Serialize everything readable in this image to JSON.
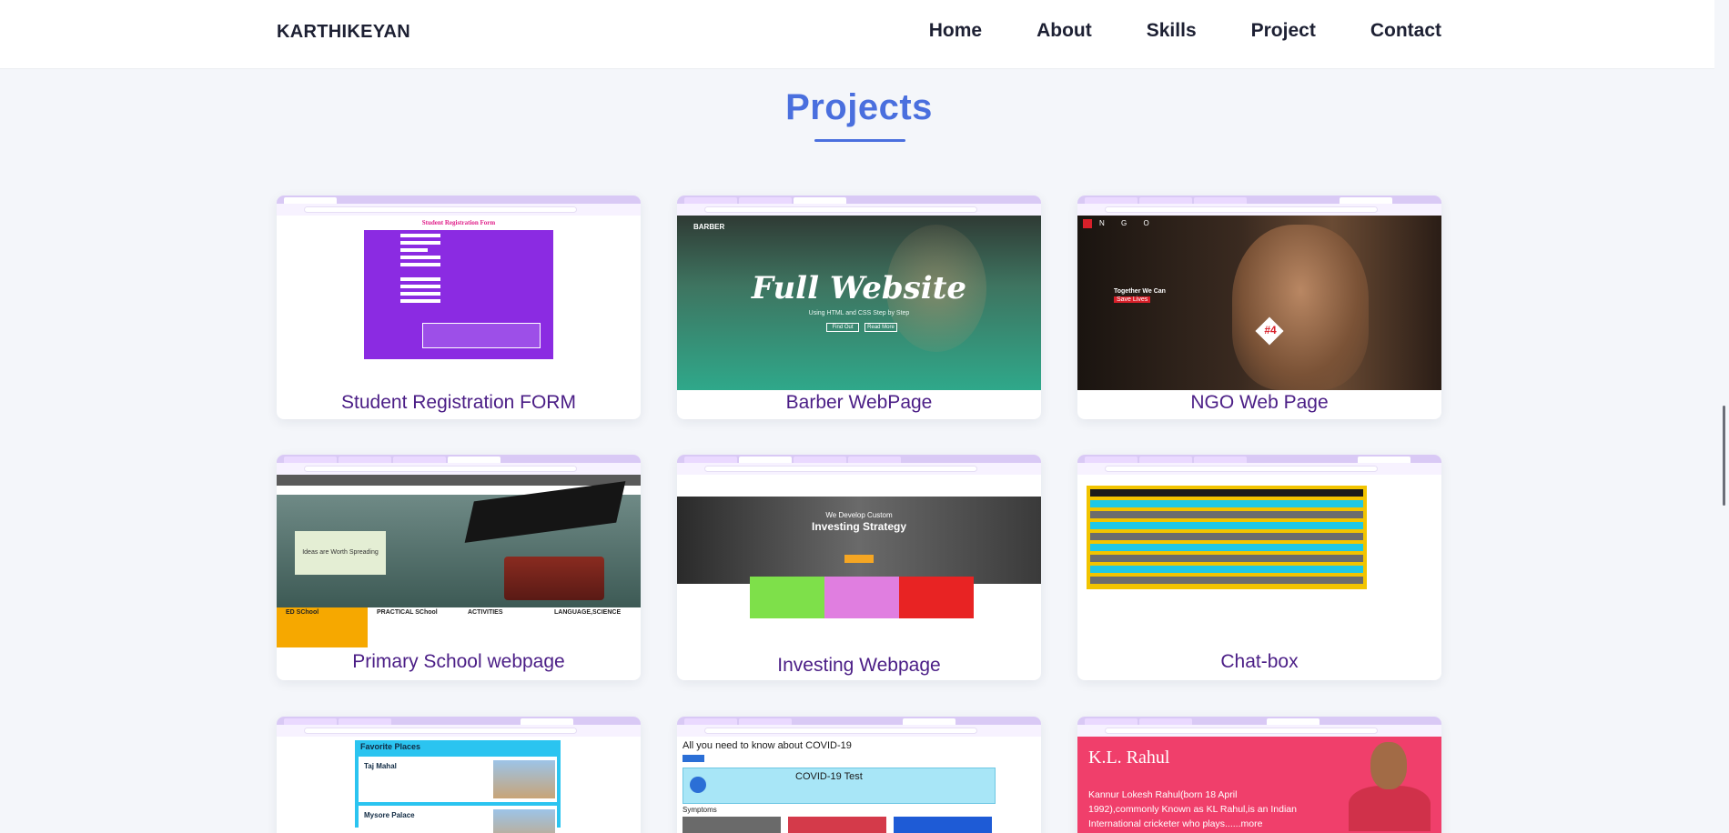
{
  "navbar": {
    "brand": "KARTHIKEYAN",
    "links": [
      "Home",
      "About",
      "Skills",
      "Project",
      "Contact"
    ]
  },
  "section": {
    "title": "Projects",
    "accent_color": "#4a6fde"
  },
  "projects": [
    {
      "label": "Student Registration FORM",
      "preview": {
        "heading": "Student Registration Form"
      }
    },
    {
      "label": "Barber WebPage",
      "preview": {
        "logo": "BARBER",
        "headline": "Full Website",
        "subline": "Using HTML and CSS Step by Step",
        "btn1": "Find Out",
        "btn2": "Read More"
      }
    },
    {
      "label": "NGO Web Page",
      "preview": {
        "logo": "N G O",
        "line1": "Together We Can",
        "line2": "Save Lives",
        "badge": "#4"
      }
    },
    {
      "label": "Primary School webpage",
      "preview": {
        "board": "Ideas are Worth Spreading",
        "col1": "ED SChool",
        "col2": "PRACTICAL SChool",
        "col3": "ACTIVITIES",
        "col4": "LANGUAGE,SCIENCE"
      }
    },
    {
      "label": "Investing Webpage",
      "preview": {
        "line1": "We Develop Custom",
        "line2": "Investing Strategy"
      }
    },
    {
      "label": "Chat-box",
      "preview": {}
    },
    {
      "label": "",
      "preview": {
        "title": "Favorite Places",
        "item1": "Taj Mahal",
        "item2": "Mysore Palace"
      }
    },
    {
      "label": "",
      "preview": {
        "title": "All you need to know about COVID-19",
        "box": "COVID-19 Test",
        "symptoms": "Symptoms"
      }
    },
    {
      "label": "",
      "preview": {
        "title": "K.L. Rahul",
        "bio": "Kannur Lokesh Rahul(born 18 April 1992),commonly Known as KL Rahul,is an Indian International cricketer who plays......more"
      }
    }
  ]
}
